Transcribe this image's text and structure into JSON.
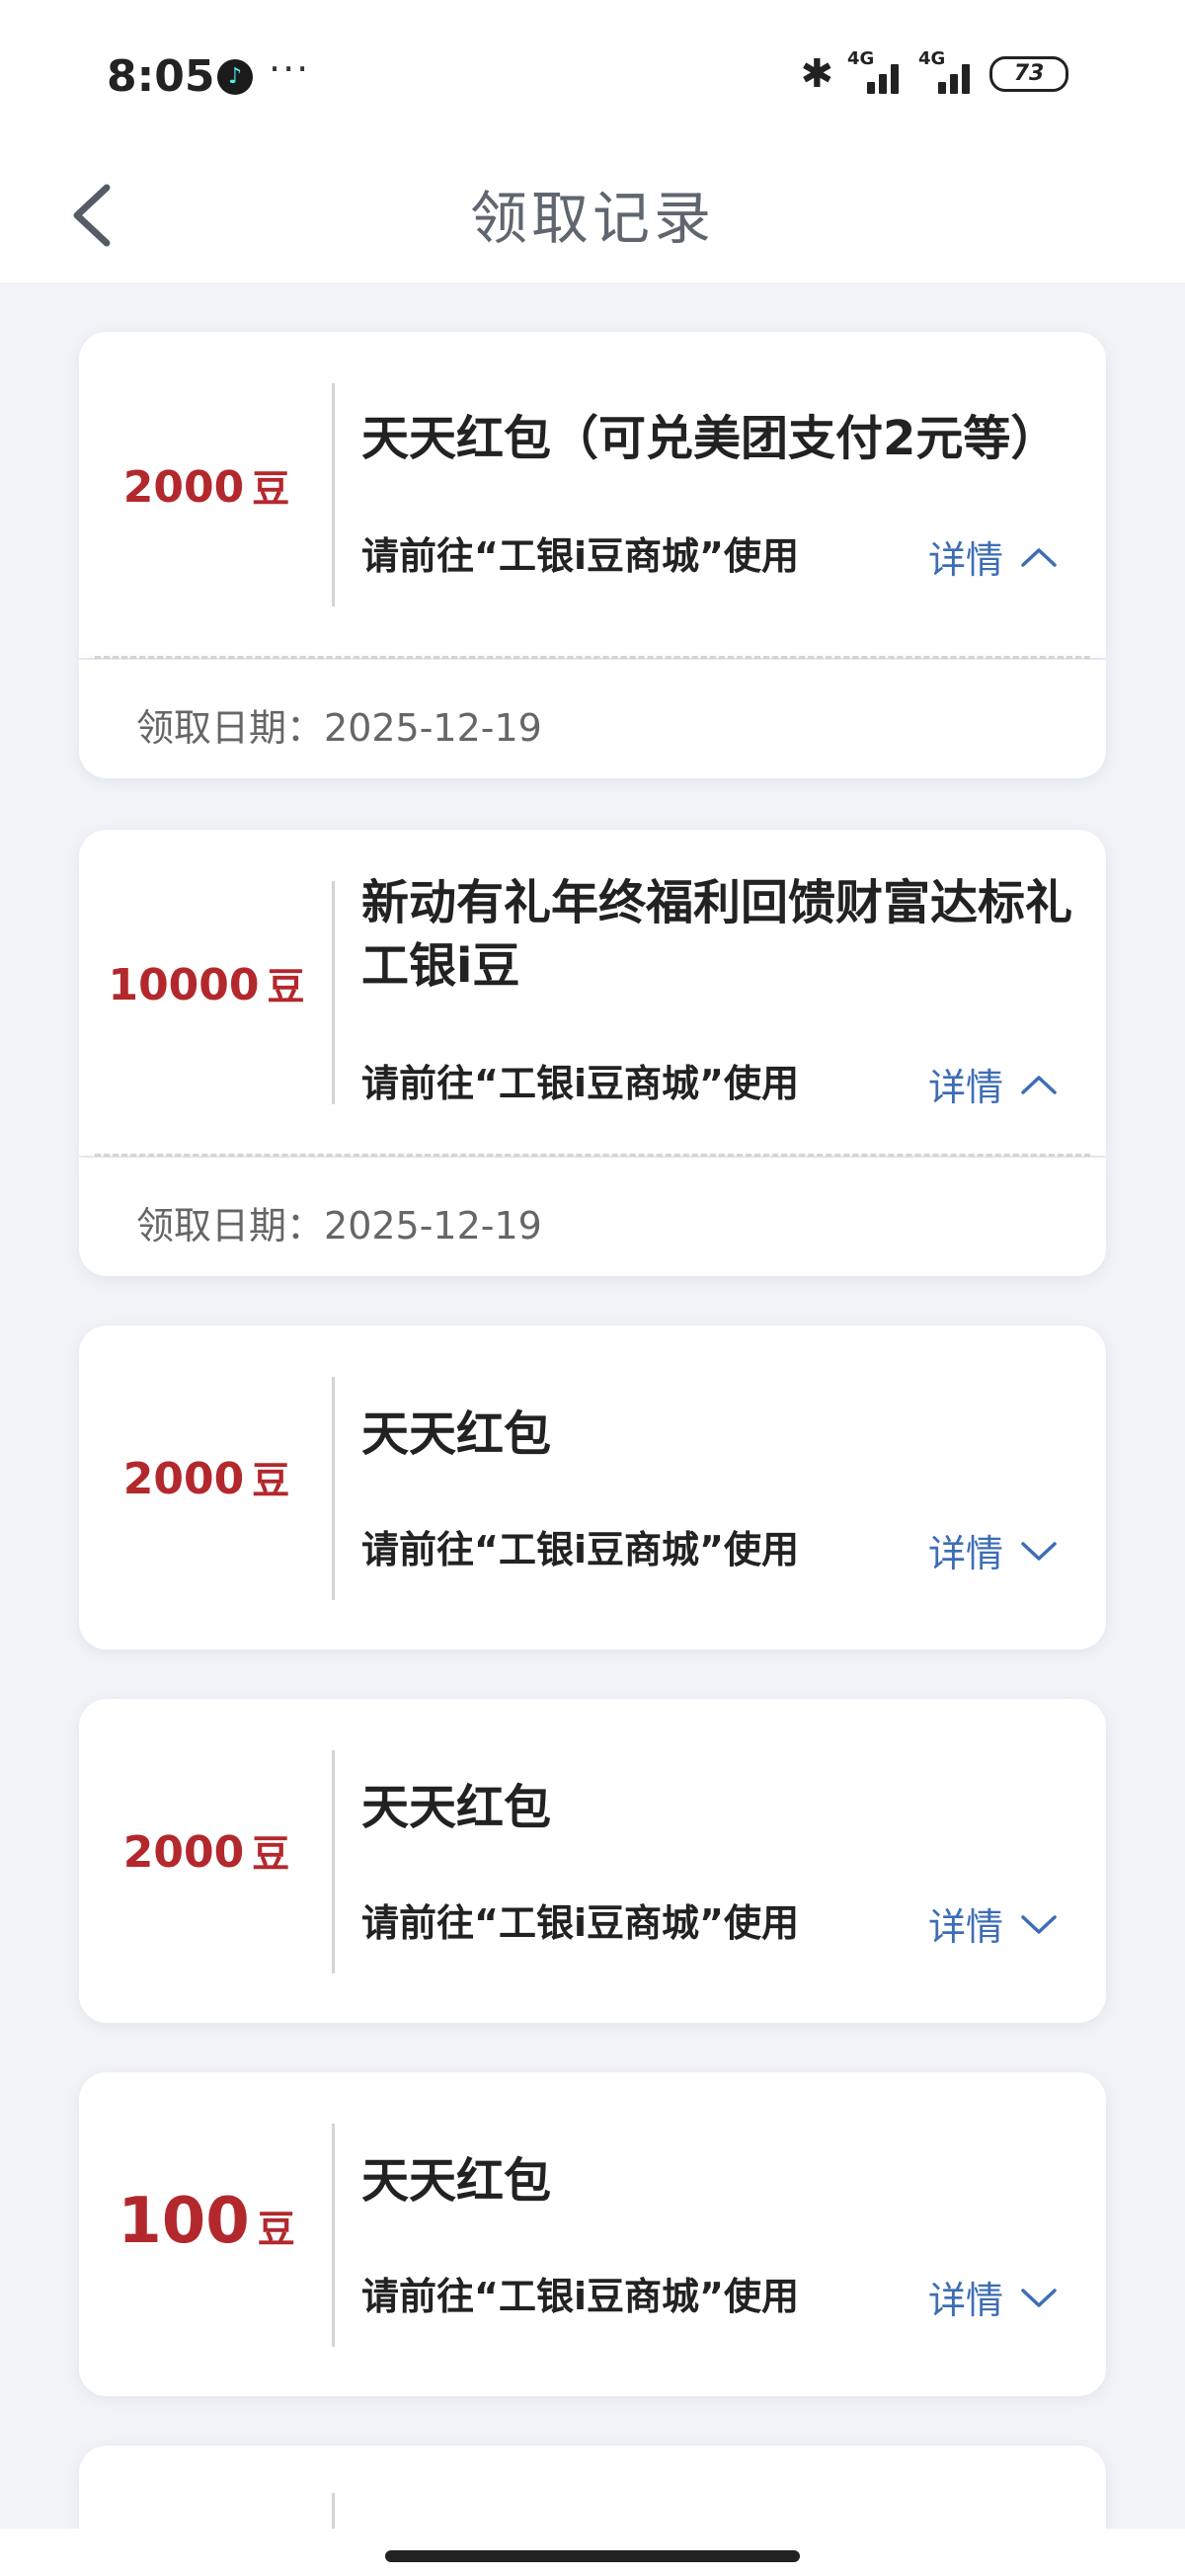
{
  "status_bar": {
    "time": "8:05",
    "more": "···",
    "signal_1": "4G",
    "signal_2": "4G",
    "battery": "73"
  },
  "nav": {
    "title": "领取记录"
  },
  "records": [
    {
      "amount": "2000",
      "unit": "豆",
      "title": "天天红包（可兑美团支付2元等）",
      "desc": "请前往“工银i豆商城”使用",
      "detail": "详情",
      "expanded": true,
      "date_label": "领取日期：",
      "date": "2025-12-19"
    },
    {
      "amount": "10000",
      "unit": "豆",
      "title": "新动有礼年终福利回馈财富达标礼工银i豆",
      "desc": "请前往“工银i豆商城”使用",
      "detail": "详情",
      "expanded": true,
      "date_label": "领取日期：",
      "date": "2025-12-19"
    },
    {
      "amount": "2000",
      "unit": "豆",
      "title": "天天红包",
      "desc": "请前往“工银i豆商城”使用",
      "detail": "详情",
      "expanded": false
    },
    {
      "amount": "2000",
      "unit": "豆",
      "title": "天天红包",
      "desc": "请前往“工银i豆商城”使用",
      "detail": "详情",
      "expanded": false
    },
    {
      "amount": "100",
      "unit": "豆",
      "title": "天天红包",
      "desc": "请前往“工银i豆商城”使用",
      "detail": "详情",
      "expanded": false
    }
  ]
}
